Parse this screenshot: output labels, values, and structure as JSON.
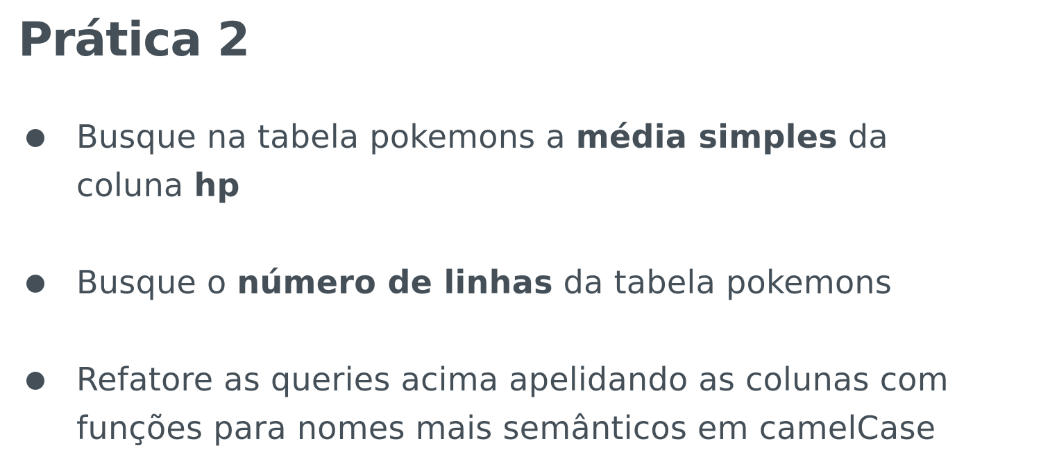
{
  "title": "Prática 2",
  "bullets": [
    {
      "line1": {
        "t1": "Busque na tabela pokemons a ",
        "b1": "média simples",
        "t2": " da"
      },
      "line2": {
        "t1": "coluna ",
        "b1": "hp"
      }
    },
    {
      "line1": {
        "t1": "Busque o ",
        "b1": "número de linhas",
        "t2": " da tabela pokemons"
      }
    },
    {
      "line1": {
        "t1": "Refatore as queries acima apelidando as colunas com"
      },
      "line2": {
        "t1": "funções para nomes mais semânticos em camelCase"
      }
    }
  ]
}
